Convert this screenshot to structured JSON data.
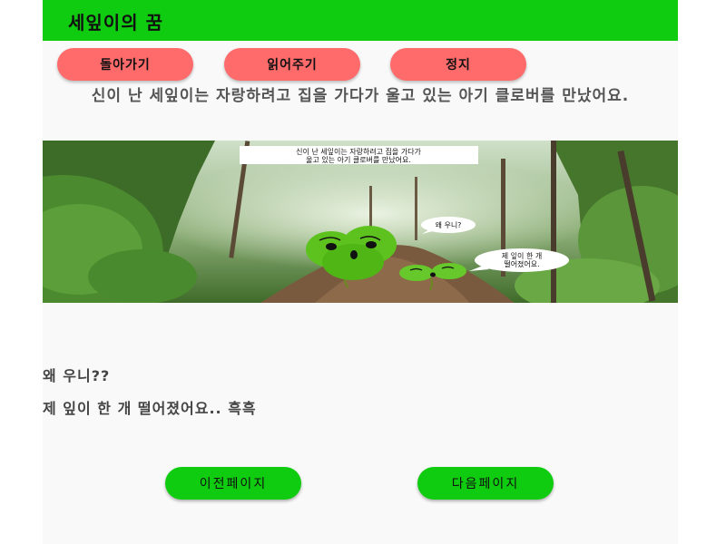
{
  "app": {
    "title": "세잎이의 꿈"
  },
  "toolbar": {
    "back_label": "돌아가기",
    "read_label": "읽어주기",
    "stop_label": "정지"
  },
  "narration": "신이 난 세잎이는 자랑하려고 집을 가다가 울고 있는 아기 클로버를 만났어요.",
  "scene": {
    "caption_line1": "신이 난 세잎이는 자랑하려고 집을 가다가",
    "caption_line2": "울고 있는 아기 클로버를 만났어요.",
    "bubble_small": "왜 우니?",
    "bubble_large_line1": "제 잎이 한 개",
    "bubble_large_line2": "떨어졌어요."
  },
  "dialogue": {
    "line1": "왜 우니??",
    "line2": "제 잎이 한 개 떨어졌어요.. 흑흑"
  },
  "nav": {
    "prev_label": "이전페이지",
    "next_label": "다음페이지"
  },
  "colors": {
    "appbar": "#10cc10",
    "pill_red": "#ff6a6a",
    "nav_green": "#10cc10"
  }
}
